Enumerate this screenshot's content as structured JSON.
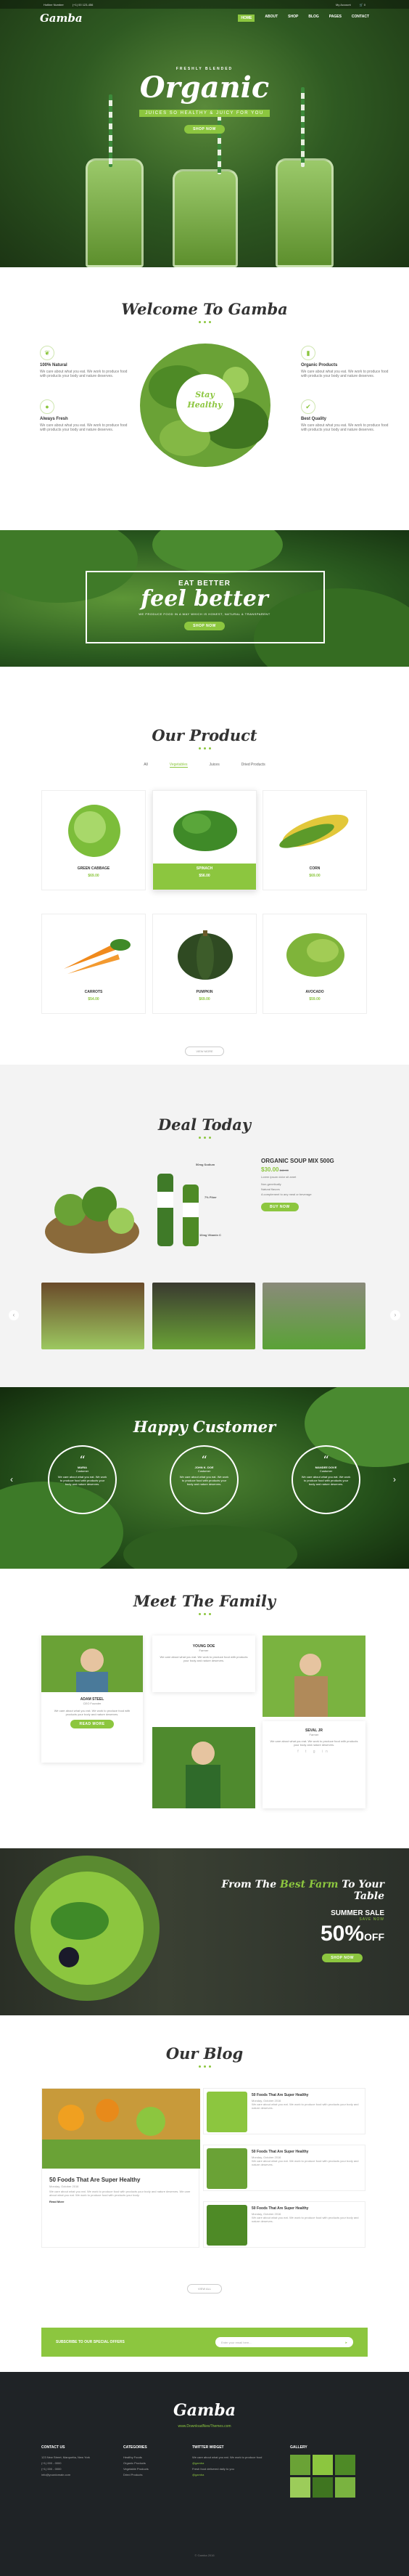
{
  "topbar": {
    "phone": "Hotline Number",
    "email": "(+1) 00 123-456",
    "account": "My Account",
    "cart": "0"
  },
  "brand": {
    "logo": "Gamba"
  },
  "nav": [
    "HOME",
    "ABOUT",
    "SHOP",
    "BLOG",
    "PAGES",
    "CONTACT"
  ],
  "hero": {
    "pre": "FRESHLY BLENDED",
    "title": "Organic",
    "sub": "JUICES SO HEALTHY & JUICY FOR YOU",
    "button": "SHOP NOW"
  },
  "welcome": {
    "title": "Welcome To Gamba",
    "badge_line1": "Stay",
    "badge_line2": "Healthy",
    "features": [
      {
        "title": "100% Natural",
        "text": "We care about what you eat. We work to produce food with products your body and nature deserves."
      },
      {
        "title": "Always Fresh",
        "text": "We care about what you eat. We work to produce food with products your body and nature deserves."
      },
      {
        "title": "Organic Products",
        "text": "We care about what you eat. We work to produce food with products your body and nature deserves."
      },
      {
        "title": "Best Quality",
        "text": "We care about what you eat. We work to produce food with products your body and nature deserves."
      }
    ]
  },
  "banner": {
    "pre": "EAT BETTER",
    "title": "feel better",
    "sub": "WE PRODUCE FOOD IN A WAY WHICH IS HONEST, NATURAL & TRANSPARENT",
    "button": "SHOP NOW"
  },
  "product": {
    "title": "Our Product",
    "tabs": [
      "All",
      "Vegetables",
      "Juices",
      "Dried Products"
    ],
    "items": [
      {
        "name": "GREEN CABBAGE",
        "price": "$69.00"
      },
      {
        "name": "SPINACH",
        "price": "$56.00"
      },
      {
        "name": "CORN",
        "price": "$69.00"
      },
      {
        "name": "CARROTS",
        "price": "$54.00"
      },
      {
        "name": "PUMPKIN",
        "price": "$69.00"
      },
      {
        "name": "AVOCADO",
        "price": "$59.00"
      }
    ],
    "button": "VIEW MORE"
  },
  "deal": {
    "title": "Deal Today",
    "product": "ORGANIC SOUP MIX 500G",
    "price": "$30.00",
    "old": "$40.00",
    "labels": [
      "50mg Sodium",
      "7% Fiber",
      "10mg Vitamin C"
    ],
    "desc": "Lorem ipsum dolor sit amet",
    "list": [
      "Non-genetically",
      "Natural flavors",
      "A complement to any meal or beverage"
    ],
    "button": "BUY NOW"
  },
  "happy": {
    "title": "Happy Customer",
    "items": [
      {
        "name": "MARIA",
        "role": "Customer",
        "text": "We care about what you eat. We work to produce food with products your body and nature deserves."
      },
      {
        "name": "JOHN K. DOE",
        "role": "Customer",
        "text": "We care about what you eat. We work to produce food with products your body and nature deserves."
      },
      {
        "name": "MANDEE DOVE",
        "role": "Customer",
        "text": "We care about what you eat. We work to produce food with products your body and nature deserves."
      }
    ]
  },
  "family": {
    "title": "Meet The Family",
    "members": [
      {
        "name": "ADAM STEEL",
        "role": "CEO Founder",
        "text": "We care about what you eat. We work to produce food with products your body and nature deserves."
      },
      {
        "name": "YOUNG DOE",
        "role": "Farmer",
        "text": "We care about what you eat. We work to produce food with products your body and nature deserves."
      },
      {
        "name": "SEVAL JR",
        "role": "Farmer",
        "text": "We care about what you eat. We work to produce food with products your body and nature deserves."
      }
    ],
    "button": "READ MORE"
  },
  "sale": {
    "line_a": "From The ",
    "line_b": "Best Farm",
    "line_c": " To Your Table",
    "label": "SUMMER SALE",
    "tag": "SAVE NOW",
    "percent": "50%",
    "off": "OFF",
    "button": "SHOP NOW"
  },
  "blog": {
    "title": "Our Blog",
    "main": {
      "title": "50 Foods That Are Super Healthy",
      "meta": "Monday, October 2016",
      "text": "We care about what you eat. We work to produce food with products your body and nature deserves. We care about what you eat. We work to produce food with products your body.",
      "more": "Read More"
    },
    "posts": [
      {
        "title": "50 Foods That Are Super Healthy",
        "meta": "Monday, October 2016",
        "text": "We care about what you eat. We work to produce food with products your body and nature deserves."
      },
      {
        "title": "50 Foods That Are Super Healthy",
        "meta": "Monday, October 2016",
        "text": "We care about what you eat. We work to produce food with products your body and nature deserves."
      },
      {
        "title": "50 Foods That Are Super Healthy",
        "meta": "Monday, October 2016",
        "text": "We care about what you eat. We work to produce food with products your body and nature deserves."
      }
    ],
    "button": "VIEW ALL"
  },
  "subscribe": {
    "label": "SUBSCRIBE TO OUR SPECIAL OFFERS",
    "placeholder": "Enter your email here..."
  },
  "footer": {
    "logo": "Gamba",
    "url": "www.DownloadNewThemes.com",
    "contact": {
      "title": "CONTACT US",
      "lines": [
        "123 New Street, Marquetta, New York",
        "(+1) 000 - 0000",
        "(+1) 000 - 0000",
        "info@yourdomain.com"
      ]
    },
    "categories": {
      "title": "CATEGORIES",
      "lines": [
        "Healthy Foods",
        "Organic Products",
        "Vegetable Products",
        "Dried Products"
      ]
    },
    "twitter": {
      "title": "TWITTER WIDGET",
      "lines": [
        "We care about what you eat. We work to produce food",
        "@gamba",
        "Fresh food delivered daily to you",
        "@gamba"
      ]
    },
    "gallery": {
      "title": "GALLERY"
    },
    "copy": "© Gamba 2016"
  }
}
